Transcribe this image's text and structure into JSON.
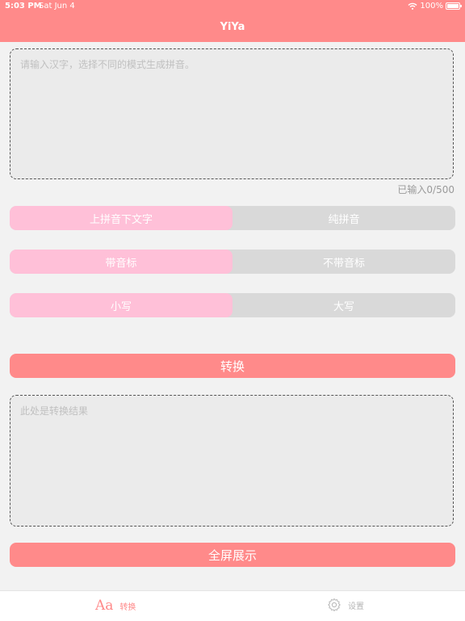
{
  "status_bar": {
    "time": "5:03 PM",
    "date": "Sat Jun 4",
    "battery": "100%"
  },
  "app": {
    "title": "YiYa"
  },
  "input": {
    "placeholder": "请输入汉字，选择不同的模式生成拼音。",
    "counter": "已输入0/500"
  },
  "segments": [
    {
      "options": [
        {
          "label": "上拼音下文字",
          "selected": true
        },
        {
          "label": "纯拼音",
          "selected": false
        }
      ]
    },
    {
      "options": [
        {
          "label": "带音标",
          "selected": true
        },
        {
          "label": "不带音标",
          "selected": false
        }
      ]
    },
    {
      "options": [
        {
          "label": "小写",
          "selected": true
        },
        {
          "label": "大写",
          "selected": false
        }
      ]
    }
  ],
  "convert_button": "转换",
  "output": {
    "placeholder": "此处是转换结果"
  },
  "fullscreen_button": "全屏展示",
  "tabs": [
    {
      "icon": "Aa",
      "label": "转换",
      "active": true
    },
    {
      "icon": "gear-icon",
      "label": "设置",
      "active": false
    }
  ],
  "colors": {
    "accent": "#ff8a8a",
    "segment_active": "#ffc0d8",
    "segment_inactive": "#d9d9d9"
  }
}
